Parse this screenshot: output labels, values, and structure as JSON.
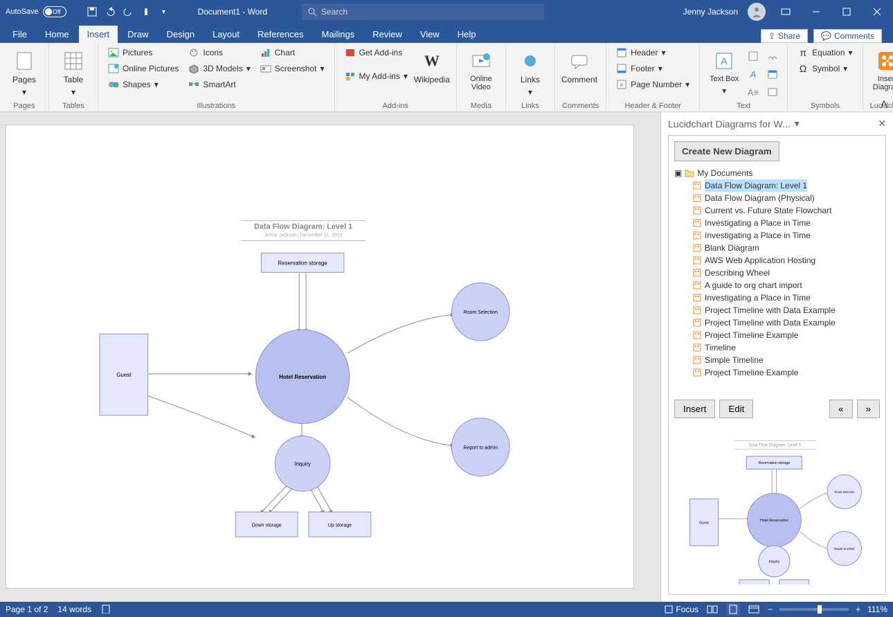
{
  "titlebar": {
    "autosave_label": "AutoSave",
    "autosave_state": "Off",
    "doc_title": "Document1 - Word",
    "search_placeholder": "Search",
    "user_name": "Jenny Jackson"
  },
  "tabs": {
    "items": [
      "File",
      "Home",
      "Insert",
      "Draw",
      "Design",
      "Layout",
      "References",
      "Mailings",
      "Review",
      "View",
      "Help"
    ],
    "active_index": 2,
    "share": "Share",
    "comments": "Comments"
  },
  "ribbon": {
    "pages": {
      "label": "Pages",
      "item": "Pages"
    },
    "tables": {
      "label": "Tables",
      "item": "Table"
    },
    "illustrations": {
      "label": "Illustrations",
      "pictures": "Pictures",
      "online_pictures": "Online Pictures",
      "shapes": "Shapes",
      "icons": "Icons",
      "models": "3D Models",
      "smartart": "SmartArt",
      "chart": "Chart",
      "screenshot": "Screenshot"
    },
    "addins": {
      "label": "Add-ins",
      "get": "Get Add-ins",
      "my": "My Add-ins",
      "wikipedia": "Wikipedia"
    },
    "media": {
      "label": "Media",
      "video": "Online Video"
    },
    "links": {
      "label": "Links",
      "item": "Links"
    },
    "comments": {
      "label": "Comments",
      "item": "Comment"
    },
    "hf": {
      "label": "Header & Footer",
      "header": "Header",
      "footer": "Footer",
      "pagenum": "Page Number"
    },
    "text": {
      "label": "Text",
      "textbox": "Text Box"
    },
    "symbols": {
      "label": "Symbols",
      "equation": "Equation",
      "symbol": "Symbol"
    },
    "lucid": {
      "label": "Lucidchart",
      "insert": "Insert Diagram"
    }
  },
  "diagram": {
    "title": "Data Flow Diagram: Level 1",
    "subtitle": "Jenny Jackson  |  December 11, 2019",
    "nodes": {
      "reservation_storage": "Reservation storage",
      "guest": "Guest",
      "hotel_reservation": "Hotel Reservation",
      "room_selection": "Room Selection",
      "report_admin": "Report to admin",
      "inquiry": "Inquiry",
      "down_storage": "Down storage",
      "up_storage": "Up storage"
    }
  },
  "sidepanel": {
    "title": "Lucidchart Diagrams for W...",
    "create": "Create New Diagram",
    "folder": "My Documents",
    "files": [
      "Data Flow Diagram: Level 1",
      "Data Flow Diagram (Physical)",
      "Current vs. Future State Flowchart",
      "Investigating a Place in Time",
      "Investigating a Place in Time",
      "Blank Diagram",
      "AWS Web Application Hosting",
      "Describing Wheel",
      "A guide to org chart import",
      "Investigating a Place in Time",
      "Project Timeline with Data Example",
      "Project Timeline with Data Example",
      "Project Timeline Example",
      "Timeline",
      "Simple Timeline",
      "Project Timeline Example"
    ],
    "selected_index": 0,
    "insert": "Insert",
    "edit": "Edit",
    "prev": "«",
    "next": "»"
  },
  "status": {
    "page": "Page 1 of 2",
    "words": "14 words",
    "focus": "Focus",
    "zoom": "111%"
  }
}
